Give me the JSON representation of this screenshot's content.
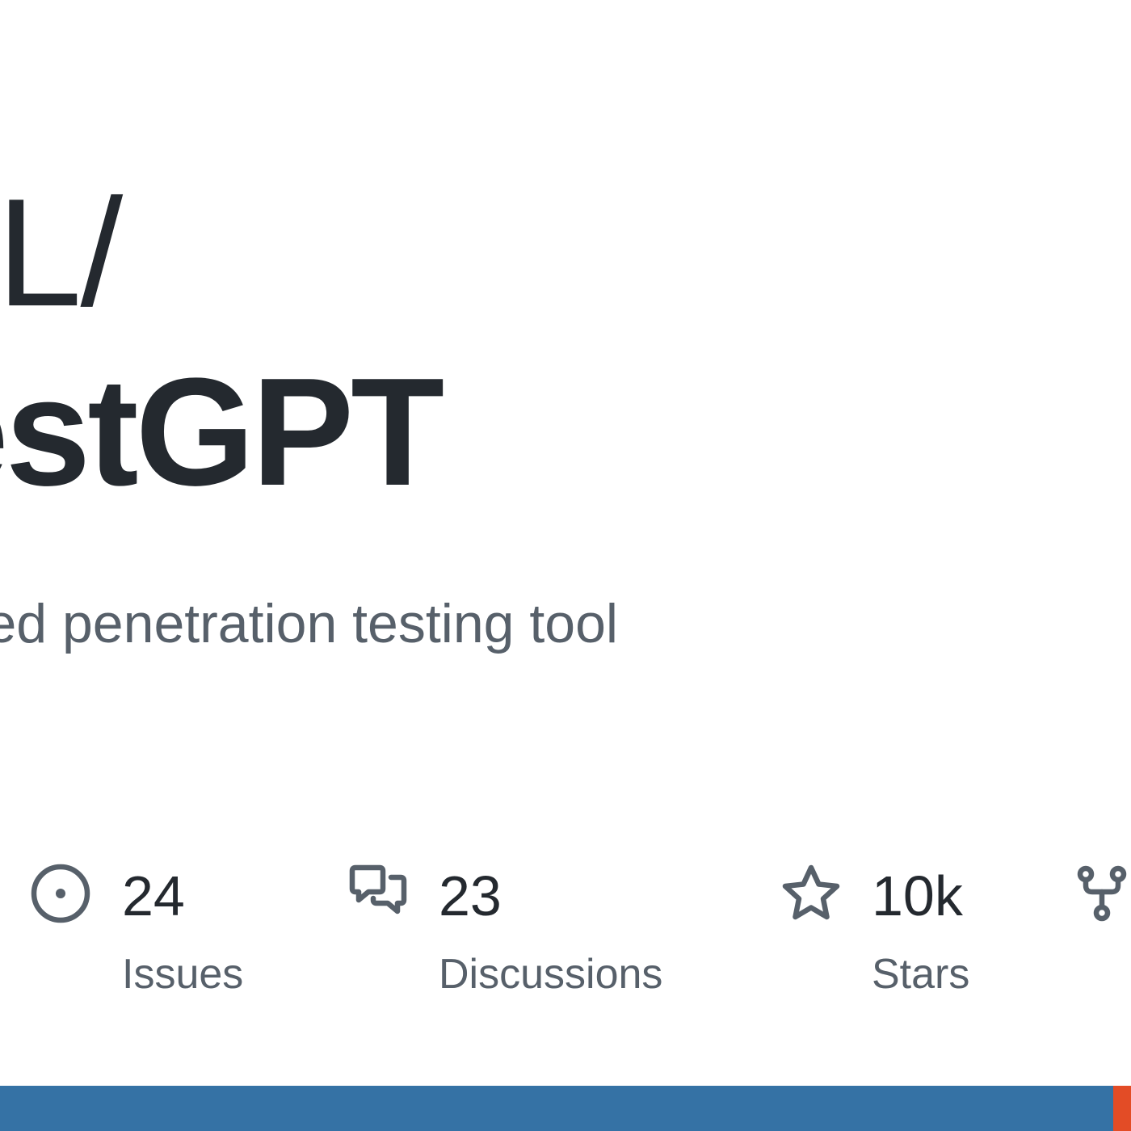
{
  "card": {
    "owner": "GL/",
    "repo": "estGPT",
    "description": "ered penetration testing tool"
  },
  "stats": {
    "issues": {
      "count": "24",
      "label": "Issues",
      "icon": "issue-opened-icon"
    },
    "discussions": {
      "count": "23",
      "label": "Discussions",
      "icon": "comment-discussion-icon"
    },
    "stars": {
      "count": "10k",
      "label": "Stars",
      "icon": "star-icon"
    },
    "forks": {
      "icon": "repo-forked-icon"
    }
  },
  "language_bar": {
    "segments": [
      {
        "color": "#3572A5",
        "fraction": 0.984
      },
      {
        "color": "#e34c26",
        "fraction": 0.016
      }
    ]
  },
  "colors": {
    "text_primary": "#24292f",
    "text_secondary": "#57606a",
    "icon": "#57606a"
  }
}
